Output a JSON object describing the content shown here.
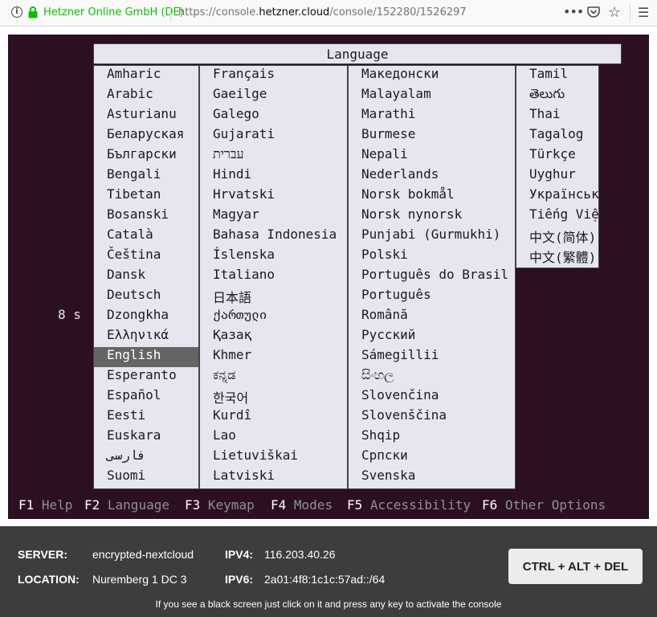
{
  "browser": {
    "site_identity": "Hetzner Online GmbH (DE)",
    "url_prefix": "https://console.",
    "url_domain": "hetzner.cloud",
    "url_path": "/console/152280/1526297",
    "more_label": "•••",
    "star_label": "☆",
    "menu_label": "☰"
  },
  "console": {
    "title": "Language",
    "timer": "8 s",
    "selected": "English",
    "columns": [
      [
        "Amharic",
        "Arabic",
        "Asturianu",
        "Беларуская",
        "Български",
        "Bengali",
        "Tibetan",
        "Bosanski",
        "Català",
        "Čeština",
        "Dansk",
        "Deutsch",
        "Dzongkha",
        "Ελληνικά",
        "English",
        "Esperanto",
        "Español",
        "Eesti",
        "Euskara",
        "فارسی",
        "Suomi"
      ],
      [
        "Français",
        "Gaeilge",
        "Galego",
        "Gujarati",
        "עברית",
        "Hindi",
        "Hrvatski",
        "Magyar",
        "Bahasa Indonesia",
        "Íslenska",
        "Italiano",
        "日本語",
        "ქართული",
        "Қазақ",
        "Khmer",
        "ಕನ್ನಡ",
        "한국어",
        "Kurdî",
        "Lao",
        "Lietuviškai",
        "Latviski"
      ],
      [
        "Македонски",
        "Malayalam",
        "Marathi",
        "Burmese",
        "Nepali",
        "Nederlands",
        "Norsk bokmål",
        "Norsk nynorsk",
        "Punjabi (Gurmukhi)",
        "Polski",
        "Português do Brasil",
        "Português",
        "Română",
        "Русский",
        "Sámegillii",
        "සිංහල",
        "Slovenčina",
        "Slovenščina",
        "Shqip",
        "Српски",
        "Svenska"
      ],
      [
        "Tamil",
        "తెలుగు",
        "Thai",
        "Tagalog",
        "Türkçe",
        "Uyghur",
        "Українська",
        "Tiếng Việt",
        "中文(简体)",
        "中文(繁體)"
      ]
    ],
    "fkeys": [
      {
        "key": "F1",
        "label": "Help"
      },
      {
        "key": "F2",
        "label": "Language"
      },
      {
        "key": "F3",
        "label": "Keymap"
      },
      {
        "key": "F4",
        "label": "Modes"
      },
      {
        "key": "F5",
        "label": "Accessibility"
      },
      {
        "key": "F6",
        "label": "Other Options"
      }
    ]
  },
  "footer": {
    "server_label": "SERVER:",
    "server_value": "encrypted-nextcloud",
    "location_label": "LOCATION:",
    "location_value": "Nuremberg 1 DC 3",
    "ipv4_label": "IPV4:",
    "ipv4_value": "116.203.40.26",
    "ipv6_label": "IPV6:",
    "ipv6_value": "2a01:4f8:1c1c:57ad::/64",
    "cad_button": "CTRL + ALT + DEL",
    "hint": "If you see a black screen just click on it and press any key to activate the console"
  },
  "colors": {
    "console_bg": "#2c0f23",
    "menu_bg": "#e6e6f0",
    "selection": "#656565",
    "site_identity": "#12bc00",
    "footer_bg": "#3d3d3d"
  }
}
